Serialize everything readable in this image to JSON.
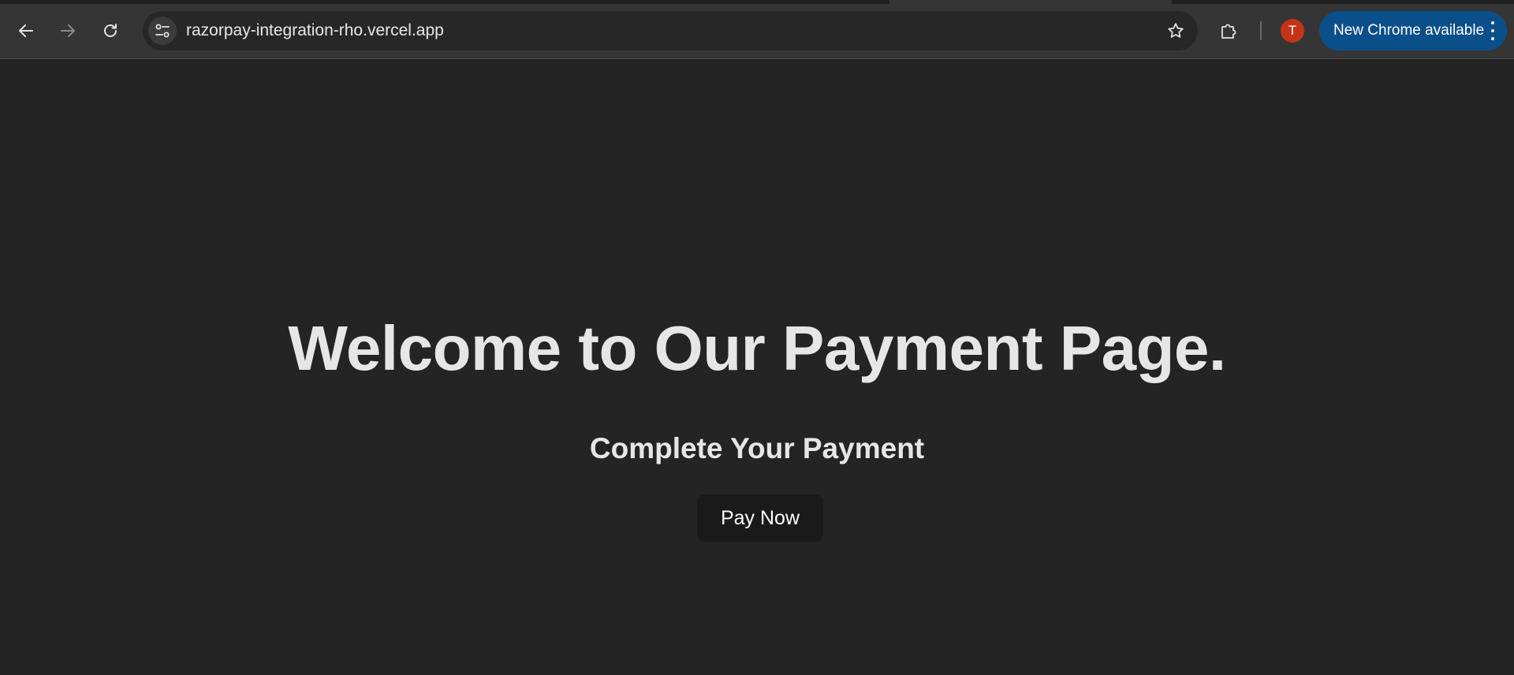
{
  "browser": {
    "url": "razorpay-integration-rho.vercel.app",
    "profile_initial": "T",
    "update_chip_label": "New Chrome available",
    "icons": {
      "back": "arrow-left-icon",
      "forward": "arrow-right-icon",
      "reload": "reload-icon",
      "site_info": "tune-icon",
      "bookmark": "star-icon",
      "extensions": "puzzle-icon",
      "menu": "kebab-menu-icon"
    },
    "colors": {
      "toolbar": "#353535",
      "omnibox": "#272727",
      "avatar": "#c53316",
      "update_chip": "#0b4f8a"
    }
  },
  "page": {
    "heading": "Welcome to Our Payment Page.",
    "subheading": "Complete Your Payment",
    "pay_button_label": "Pay Now",
    "colors": {
      "background": "#242424",
      "text": "#e6e6e6",
      "button": "#1a1a1a"
    }
  }
}
